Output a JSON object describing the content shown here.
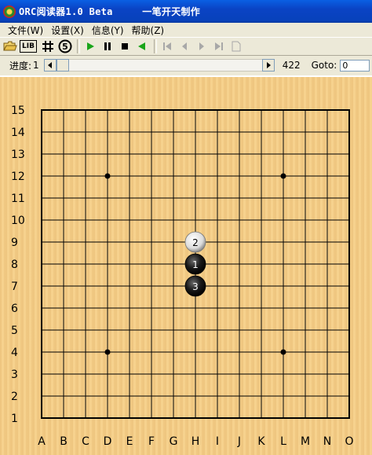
{
  "titlebar": {
    "title": "ORC阅读器1.0 Beta     一笔开天制作"
  },
  "menu": [
    {
      "label": "文件(W)"
    },
    {
      "label": "设置(X)"
    },
    {
      "label": "信息(Y)"
    },
    {
      "label": "帮助(Z)"
    }
  ],
  "toolbar": {
    "lib_label": "LIB",
    "count_label": "5"
  },
  "progress": {
    "label": "进度:",
    "current": "1",
    "total": "422",
    "fraction": 0.0,
    "goto_label": "Goto:",
    "goto_value": "0"
  },
  "board": {
    "size": 15,
    "col_labels": [
      "A",
      "B",
      "C",
      "D",
      "E",
      "F",
      "G",
      "H",
      "I",
      "J",
      "K",
      "L",
      "M",
      "N",
      "O"
    ],
    "row_labels": [
      "15",
      "14",
      "13",
      "12",
      "11",
      "10",
      "9",
      "8",
      "7",
      "6",
      "5",
      "4",
      "3",
      "2",
      "1"
    ],
    "star_points": [
      {
        "col": "D",
        "row": 12
      },
      {
        "col": "L",
        "row": 12
      },
      {
        "col": "D",
        "row": 4
      },
      {
        "col": "L",
        "row": 4
      }
    ],
    "stones": [
      {
        "color": "white",
        "col": "H",
        "row": 9,
        "label": "2"
      },
      {
        "color": "black",
        "col": "H",
        "row": 8,
        "label": "1"
      },
      {
        "color": "black",
        "col": "H",
        "row": 7,
        "label": "3"
      }
    ]
  },
  "colors": {
    "title_bar": "#0a46c8",
    "board": "#f5cf8a",
    "grid": "#000000"
  }
}
